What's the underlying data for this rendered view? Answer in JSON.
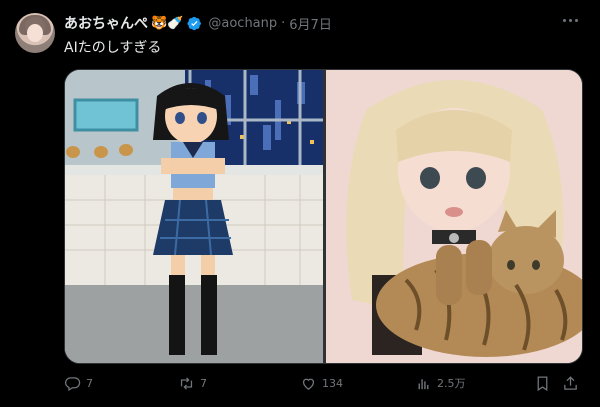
{
  "author": {
    "display_name": "あおちゃんぺ",
    "emoji": "🐯🍼",
    "handle": "@aochanp",
    "date": "6月7日"
  },
  "tweet": {
    "text": "AIたのしすぎる"
  },
  "media": {
    "images": [
      {
        "description": "pixel-art anime girl"
      },
      {
        "description": "illustrated girl holding tabby cat"
      }
    ]
  },
  "actions": {
    "reply": "7",
    "retweet": "7",
    "like": "134",
    "views": "2.5万"
  },
  "colors": {
    "background": "#000000",
    "text": "#e7e9ea",
    "muted": "#71767b",
    "verified": "#1d9bf0"
  }
}
